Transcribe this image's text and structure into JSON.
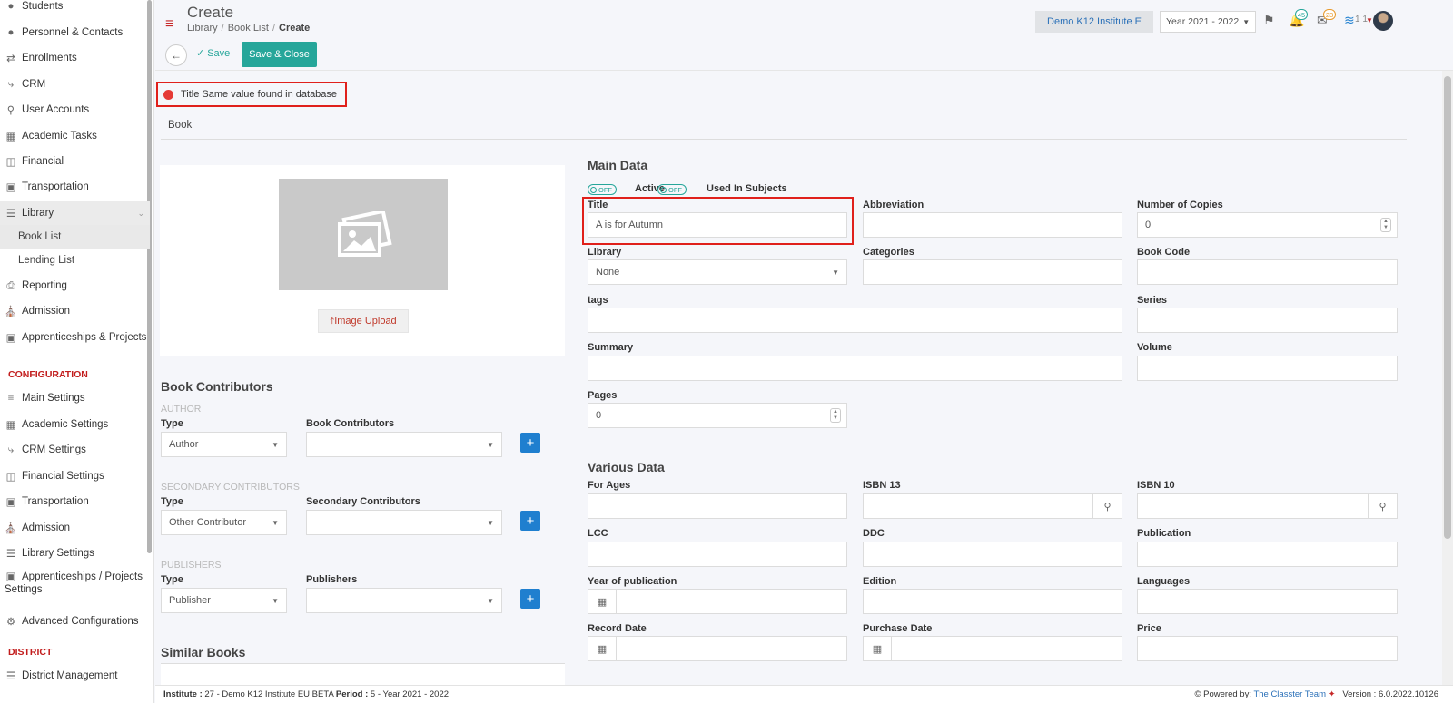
{
  "sidebar": {
    "items": [
      {
        "label": "Students",
        "icon": "students-icon"
      },
      {
        "label": "Personnel & Contacts",
        "icon": "personnel-icon"
      },
      {
        "label": "Enrollments",
        "icon": "enrollments-icon"
      },
      {
        "label": "CRM",
        "icon": "crm-icon"
      },
      {
        "label": "User Accounts",
        "icon": "key-icon"
      },
      {
        "label": "Academic Tasks",
        "icon": "grid-icon"
      },
      {
        "label": "Financial",
        "icon": "coins-icon"
      },
      {
        "label": "Transportation",
        "icon": "bus-icon"
      },
      {
        "label": "Library",
        "icon": "books-icon"
      }
    ],
    "library_sub": [
      "Book List",
      "Lending List"
    ],
    "items2": [
      {
        "label": "Reporting",
        "icon": "printer-icon"
      },
      {
        "label": "Admission",
        "icon": "bank-icon"
      },
      {
        "label": "Apprenticeships & Projects",
        "icon": "box-icon"
      }
    ],
    "config_header": "CONFIGURATION",
    "config_items": [
      {
        "label": "Main Settings",
        "icon": "sliders-icon"
      },
      {
        "label": "Academic Settings",
        "icon": "academic-icon"
      },
      {
        "label": "CRM Settings",
        "icon": "crm-icon"
      },
      {
        "label": "Financial Settings",
        "icon": "coins-icon"
      },
      {
        "label": "Transportation",
        "icon": "bus-icon"
      },
      {
        "label": "Admission",
        "icon": "bank-icon"
      },
      {
        "label": "Library Settings",
        "icon": "books-icon"
      }
    ],
    "config_two_line_1": "Apprenticeships / Projects",
    "config_two_line_2": "Settings",
    "config_advanced": "Advanced Configurations",
    "district_header": "DISTRICT",
    "district_item": "District Management"
  },
  "header": {
    "title": "Create",
    "breadcrumb": [
      "Library",
      "Book List",
      "Create"
    ],
    "institute": "Demo K12 Institute E",
    "year": "Year 2021 - 2022",
    "notif_count": "45",
    "mail_count": "23",
    "user_short": "1 1"
  },
  "toolbar": {
    "save_label": "Save",
    "save_close_label": "Save & Close"
  },
  "error": {
    "message": "Title Same value found in database"
  },
  "tab": {
    "label": "Book"
  },
  "image": {
    "upload_label": "Image Upload"
  },
  "contributors": {
    "title": "Book Contributors",
    "author_cap": "AUTHOR",
    "type_label": "Type",
    "author_type": "Author",
    "book_contrib_label": "Book Contributors",
    "secondary_cap": "SECONDARY CONTRIBUTORS",
    "secondary_type": "Other Contributor",
    "secondary_label": "Secondary Contributors",
    "publishers_cap": "PUBLISHERS",
    "publisher_type": "Publisher",
    "publishers_label": "Publishers"
  },
  "similar": {
    "title": "Similar Books"
  },
  "main_data": {
    "title": "Main Data",
    "toggle_off": "OFF",
    "active_label": "Active",
    "used_label": "Used In Subjects",
    "fields": {
      "title_label": "Title",
      "title_value": "A is for Autumn",
      "abbreviation_label": "Abbreviation",
      "copies_label": "Number of Copies",
      "copies_value": "0",
      "library_label": "Library",
      "library_value": "None",
      "categories_label": "Categories",
      "bookcode_label": "Book Code",
      "tags_label": "tags",
      "series_label": "Series",
      "summary_label": "Summary",
      "volume_label": "Volume",
      "pages_label": "Pages",
      "pages_value": "0"
    }
  },
  "various": {
    "title": "Various Data",
    "for_ages": "For Ages",
    "isbn13": "ISBN 13",
    "isbn10": "ISBN 10",
    "lcc": "LCC",
    "ddc": "DDC",
    "publication": "Publication",
    "year_pub": "Year of publication",
    "edition": "Edition",
    "languages": "Languages",
    "record_date": "Record Date",
    "purchase_date": "Purchase Date",
    "price": "Price"
  },
  "footer": {
    "institute_label": "Institute :",
    "institute_value": "27 - Demo K12 Institute EU BETA",
    "period_label": "Period :",
    "period_value": "5 - Year 2021 - 2022",
    "powered": "Powered by:",
    "team": "The Classter Team",
    "version": "| Version : 6.0.2022.10126"
  }
}
